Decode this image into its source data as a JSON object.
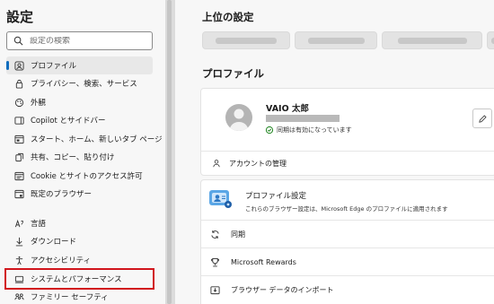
{
  "sidebar": {
    "title": "設定",
    "search_placeholder": "設定の検索",
    "items": [
      {
        "label": "プロファイル",
        "icon": "profile-icon"
      },
      {
        "label": "プライバシー、検索、サービス",
        "icon": "lock-icon"
      },
      {
        "label": "外観",
        "icon": "appearance-icon"
      },
      {
        "label": "Copilot とサイドバー",
        "icon": "sidebar-icon"
      },
      {
        "label": "スタート、ホーム、新しいタブ ページ",
        "icon": "home-icon"
      },
      {
        "label": "共有、コピー、貼り付け",
        "icon": "share-icon"
      },
      {
        "label": "Cookie とサイトのアクセス許可",
        "icon": "cookie-icon"
      },
      {
        "label": "既定のブラウザー",
        "icon": "browser-icon"
      },
      {
        "label": "言語",
        "icon": "language-icon"
      },
      {
        "label": "ダウンロード",
        "icon": "download-icon"
      },
      {
        "label": "アクセシビリティ",
        "icon": "accessibility-icon"
      },
      {
        "label": "システムとパフォーマンス",
        "icon": "system-icon"
      },
      {
        "label": "ファミリー セーフティ",
        "icon": "family-icon"
      }
    ]
  },
  "main": {
    "top_heading": "上位の設定",
    "profile_heading": "プロファイル",
    "user_name": "VAIO 太郎",
    "sync_status": "同期は有効になっています",
    "account_manage": "アカウントの管理",
    "profile_settings_title": "プロファイル設定",
    "profile_settings_desc": "これらのブラウザー設定は、Microsoft Edge のプロファイルに適用されます",
    "rows": [
      {
        "label": "同期",
        "icon": "sync-icon"
      },
      {
        "label": "Microsoft Rewards",
        "icon": "rewards-icon"
      },
      {
        "label": "ブラウザー データのインポート",
        "icon": "import-icon"
      }
    ]
  },
  "colors": {
    "accent": "#0f6cbd",
    "highlight": "#d1141c",
    "sync_ok": "#107c10"
  }
}
